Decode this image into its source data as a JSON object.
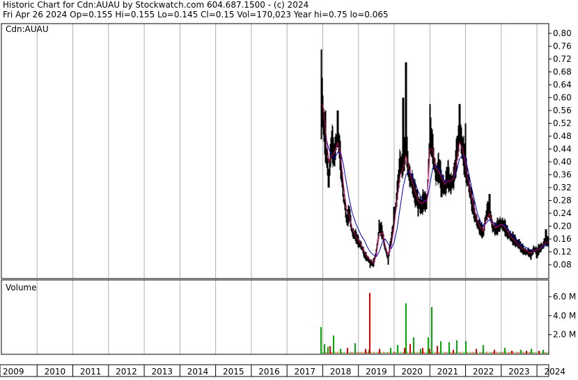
{
  "header": {
    "line1": "Historic Chart for Cdn:AUAU by Stockwatch.com 604.687.1500 - (c) 2024",
    "line2": "Fri Apr 26 2024   Op=0.155  Hi=0.155  Lo=0.145  Cl=0.15  Vol=170,023  Year hi=0.75  lo=0.065"
  },
  "colors": {
    "background": "#ffffff",
    "grid": "#b0b0b0",
    "frame": "#000000",
    "price_bars": "#000000",
    "ma_short": "#cc0066",
    "ma_long": "#0000cc",
    "volume_up": "#00aa00",
    "volume_down": "#dd0000"
  },
  "chart_data": [
    {
      "type": "line",
      "title": "Historic Chart for Cdn:AUAU by Stockwatch.com 604.687.1500 - (c) 2024",
      "panel_label": "Cdn:AUAU",
      "ylim": [
        0.06,
        0.82
      ],
      "y_ticks": [
        0.8,
        0.76,
        0.72,
        0.68,
        0.64,
        0.6,
        0.56,
        0.52,
        0.48,
        0.44,
        0.4,
        0.36,
        0.32,
        0.28,
        0.24,
        0.2,
        0.16,
        0.12,
        0.08
      ],
      "y_tick_labels": [
        "0.80",
        "0.76",
        "0.72",
        "0.68",
        "0.64",
        "0.60",
        "0.56",
        "0.52",
        "0.48",
        "0.44",
        "0.40",
        "0.36",
        "0.32",
        "0.28",
        "0.24",
        "0.20",
        "0.16",
        "0.12",
        "0.08"
      ],
      "x_range": [
        2009.0,
        2024.33
      ],
      "x_tick_labels": [
        "2009",
        "2010",
        "2011",
        "2012",
        "2013",
        "2014",
        "2015",
        "2016",
        "2017",
        "2018",
        "2019",
        "2020",
        "2021",
        "2022",
        "2023",
        "2024"
      ],
      "grid": true,
      "series": [
        {
          "key": "close",
          "x": [
            2017.95,
            2018.0,
            2018.08,
            2018.17,
            2018.25,
            2018.33,
            2018.42,
            2018.5,
            2018.58,
            2018.67,
            2018.75,
            2018.83,
            2018.92,
            2019.0,
            2019.08,
            2019.17,
            2019.25,
            2019.33,
            2019.42,
            2019.5,
            2019.58,
            2019.67,
            2019.75,
            2019.83,
            2019.92,
            2020.0,
            2020.08,
            2020.17,
            2020.25,
            2020.33,
            2020.42,
            2020.5,
            2020.58,
            2020.67,
            2020.75,
            2020.83,
            2020.92,
            2021.0,
            2021.08,
            2021.17,
            2021.25,
            2021.33,
            2021.42,
            2021.5,
            2021.58,
            2021.67,
            2021.75,
            2021.83,
            2021.92,
            2022.0,
            2022.08,
            2022.17,
            2022.25,
            2022.33,
            2022.42,
            2022.5,
            2022.58,
            2022.67,
            2022.75,
            2022.83,
            2022.92,
            2023.0,
            2023.08,
            2023.17,
            2023.25,
            2023.33,
            2023.42,
            2023.5,
            2023.58,
            2023.67,
            2023.75,
            2023.83,
            2023.92,
            2024.0,
            2024.08,
            2024.17,
            2024.25,
            2024.32
          ],
          "y": [
            0.68,
            0.56,
            0.44,
            0.36,
            0.46,
            0.42,
            0.5,
            0.4,
            0.3,
            0.22,
            0.24,
            0.18,
            0.17,
            0.15,
            0.14,
            0.11,
            0.1,
            0.09,
            0.08,
            0.12,
            0.2,
            0.18,
            0.13,
            0.1,
            0.16,
            0.22,
            0.3,
            0.4,
            0.38,
            0.46,
            0.36,
            0.34,
            0.3,
            0.28,
            0.26,
            0.28,
            0.27,
            0.5,
            0.44,
            0.36,
            0.38,
            0.34,
            0.32,
            0.36,
            0.33,
            0.35,
            0.42,
            0.5,
            0.44,
            0.38,
            0.34,
            0.28,
            0.24,
            0.21,
            0.19,
            0.18,
            0.24,
            0.26,
            0.2,
            0.19,
            0.2,
            0.21,
            0.2,
            0.18,
            0.17,
            0.16,
            0.15,
            0.14,
            0.13,
            0.12,
            0.12,
            0.11,
            0.13,
            0.12,
            0.13,
            0.14,
            0.16,
            0.15
          ]
        },
        {
          "key": "high",
          "x": [
            2017.95,
            2018.08,
            2018.42,
            2019.42,
            2019.58,
            2020.0,
            2020.25,
            2020.33,
            2020.92,
            2021.0,
            2021.83,
            2022.0,
            2022.67,
            2023.5,
            2024.08,
            2024.25
          ],
          "y": [
            0.75,
            0.56,
            0.56,
            0.1,
            0.22,
            0.26,
            0.6,
            0.71,
            0.3,
            0.58,
            0.58,
            0.52,
            0.3,
            0.16,
            0.14,
            0.19
          ]
        },
        {
          "key": "low",
          "x": [
            2017.95,
            2018.17,
            2019.33,
            2019.42,
            2019.83,
            2020.67,
            2021.33,
            2022.5,
            2023.83,
            2024.0
          ],
          "y": [
            0.47,
            0.32,
            0.07,
            0.075,
            0.08,
            0.23,
            0.29,
            0.17,
            0.095,
            0.1
          ]
        },
        {
          "name": "",
          "key": "ma_short",
          "x": [
            2018.0,
            2018.08,
            2018.17,
            2018.25,
            2018.33,
            2018.42,
            2018.5,
            2018.58,
            2018.67,
            2018.75,
            2018.83,
            2018.92,
            2019.0,
            2019.08,
            2019.17,
            2019.25,
            2019.33,
            2019.42,
            2019.5,
            2019.58,
            2019.67,
            2019.75,
            2019.83,
            2019.92,
            2020.0,
            2020.08,
            2020.17,
            2020.25,
            2020.33,
            2020.42,
            2020.5,
            2020.58,
            2020.67,
            2020.75,
            2020.83,
            2020.92,
            2021.0,
            2021.08,
            2021.17,
            2021.25,
            2021.33,
            2021.42,
            2021.5,
            2021.58,
            2021.67,
            2021.75,
            2021.83,
            2021.92,
            2022.0,
            2022.08,
            2022.17,
            2022.25,
            2022.33,
            2022.42,
            2022.5,
            2022.58,
            2022.67,
            2022.75,
            2022.83,
            2022.92,
            2023.0,
            2023.08,
            2023.17,
            2023.25,
            2023.33,
            2023.42,
            2023.5,
            2023.58,
            2023.67,
            2023.75,
            2023.83,
            2023.92,
            2024.0,
            2024.08,
            2024.17,
            2024.25,
            2024.32
          ],
          "y": [
            0.58,
            0.5,
            0.4,
            0.42,
            0.43,
            0.46,
            0.42,
            0.33,
            0.25,
            0.23,
            0.19,
            0.17,
            0.155,
            0.14,
            0.12,
            0.105,
            0.095,
            0.085,
            0.11,
            0.17,
            0.18,
            0.14,
            0.11,
            0.14,
            0.2,
            0.28,
            0.36,
            0.38,
            0.42,
            0.38,
            0.34,
            0.31,
            0.28,
            0.27,
            0.275,
            0.28,
            0.44,
            0.44,
            0.38,
            0.37,
            0.35,
            0.33,
            0.34,
            0.34,
            0.35,
            0.4,
            0.46,
            0.44,
            0.39,
            0.34,
            0.29,
            0.25,
            0.215,
            0.195,
            0.185,
            0.22,
            0.24,
            0.21,
            0.195,
            0.2,
            0.205,
            0.2,
            0.185,
            0.17,
            0.16,
            0.15,
            0.14,
            0.13,
            0.125,
            0.12,
            0.115,
            0.125,
            0.125,
            0.13,
            0.14,
            0.15,
            0.15
          ]
        },
        {
          "name": "",
          "key": "ma_long",
          "x": [
            2018.08,
            2018.17,
            2018.25,
            2018.33,
            2018.42,
            2018.5,
            2018.58,
            2018.67,
            2018.75,
            2018.83,
            2018.92,
            2019.0,
            2019.08,
            2019.17,
            2019.25,
            2019.33,
            2019.42,
            2019.5,
            2019.58,
            2019.67,
            2019.75,
            2019.83,
            2019.92,
            2020.0,
            2020.08,
            2020.17,
            2020.25,
            2020.33,
            2020.42,
            2020.5,
            2020.58,
            2020.67,
            2020.75,
            2020.83,
            2020.92,
            2021.0,
            2021.08,
            2021.17,
            2021.25,
            2021.33,
            2021.42,
            2021.5,
            2021.58,
            2021.67,
            2021.75,
            2021.83,
            2021.92,
            2022.0,
            2022.08,
            2022.17,
            2022.25,
            2022.33,
            2022.42,
            2022.5,
            2022.58,
            2022.67,
            2022.75,
            2022.83,
            2022.92,
            2023.0,
            2023.08,
            2023.17,
            2023.25,
            2023.33,
            2023.42,
            2023.5,
            2023.58,
            2023.67,
            2023.75,
            2023.83,
            2023.92,
            2024.0,
            2024.08,
            2024.17,
            2024.25,
            2024.32
          ],
          "y": [
            0.48,
            0.44,
            0.42,
            0.41,
            0.43,
            0.43,
            0.39,
            0.33,
            0.28,
            0.24,
            0.21,
            0.19,
            0.17,
            0.155,
            0.135,
            0.12,
            0.11,
            0.105,
            0.12,
            0.15,
            0.16,
            0.145,
            0.13,
            0.15,
            0.19,
            0.26,
            0.32,
            0.36,
            0.37,
            0.36,
            0.34,
            0.31,
            0.29,
            0.28,
            0.28,
            0.33,
            0.38,
            0.39,
            0.38,
            0.36,
            0.34,
            0.34,
            0.34,
            0.35,
            0.37,
            0.41,
            0.42,
            0.41,
            0.37,
            0.32,
            0.28,
            0.24,
            0.215,
            0.2,
            0.21,
            0.22,
            0.215,
            0.205,
            0.2,
            0.205,
            0.205,
            0.195,
            0.18,
            0.17,
            0.16,
            0.15,
            0.14,
            0.135,
            0.13,
            0.125,
            0.125,
            0.125,
            0.13,
            0.135,
            0.14,
            0.145
          ]
        }
      ]
    },
    {
      "type": "bar",
      "title": "",
      "panel_label": "Volume",
      "ylim": [
        0,
        7.0
      ],
      "y_ticks": [
        2.0,
        4.0,
        6.0
      ],
      "y_tick_labels": [
        "2.0 M",
        "4.0 M",
        "6.0 M"
      ],
      "unit": "M",
      "series": [
        {
          "key": "up",
          "x": [
            2017.95,
            2018.05,
            2018.15,
            2018.3,
            2018.5,
            2018.9,
            2019.3,
            2019.9,
            2020.1,
            2020.33,
            2020.55,
            2020.75,
            2020.95,
            2021.05,
            2021.3,
            2021.55,
            2021.75,
            2022.0,
            2022.5,
            2023.1,
            2023.55,
            2023.85,
            2024.18
          ],
          "y": [
            2.8,
            1.0,
            0.7,
            1.9,
            0.5,
            1.1,
            0.4,
            0.6,
            0.9,
            5.3,
            1.7,
            0.5,
            1.7,
            4.9,
            1.3,
            1.2,
            1.4,
            1.3,
            0.9,
            0.6,
            0.4,
            0.5,
            0.4
          ]
        },
        {
          "key": "down",
          "x": [
            2018.2,
            2018.7,
            2019.2,
            2019.32,
            2019.6,
            2020.3,
            2020.45,
            2020.8,
            2021.0,
            2021.2,
            2021.65,
            2022.3,
            2022.8,
            2023.3,
            2023.7,
            2024.05
          ],
          "y": [
            0.8,
            0.6,
            0.5,
            6.4,
            0.5,
            0.6,
            1.0,
            0.6,
            0.5,
            0.8,
            0.4,
            0.5,
            0.4,
            0.3,
            0.3,
            0.3
          ]
        }
      ]
    }
  ]
}
